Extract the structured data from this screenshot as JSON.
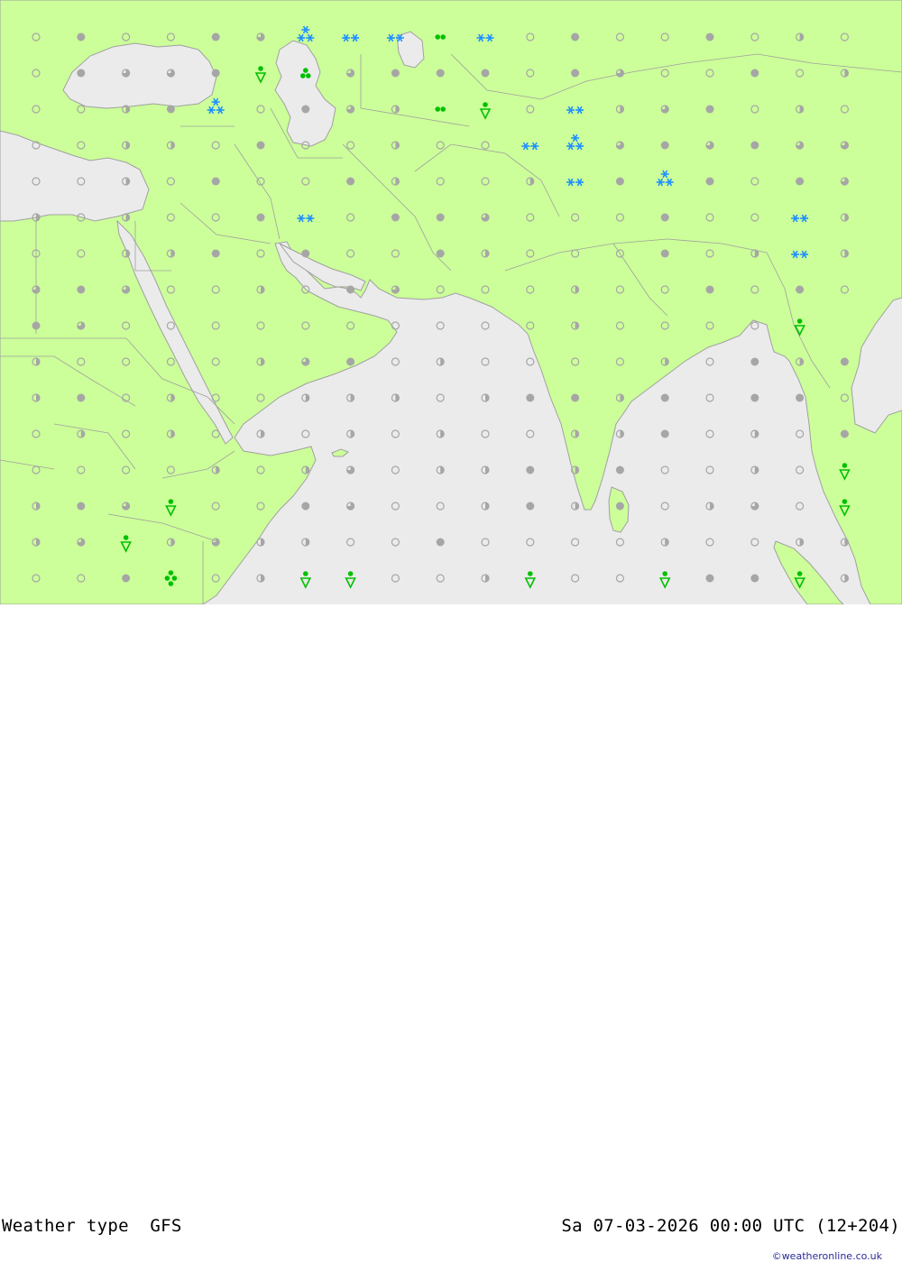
{
  "title": {
    "label": "Weather type",
    "model": "GFS",
    "datetime": "Sa 07-03-2026 00:00 UTC (12+204)"
  },
  "credit": "©weatheronline.co.uk",
  "colors": {
    "land": "#ccff99",
    "sea": "#ebebeb",
    "border": "#a0a0a0",
    "dot": "#a6a6a6",
    "snow": "#1e90ff",
    "rain": "#00c000"
  },
  "grid": {
    "cols": 19,
    "rows": 16,
    "symbols": [
      "ocoocfsssrsocoocoho",
      "ocffcdlfcccocfoocoh",
      "oohcsocfhrdoshfcoho",
      "oohhocoohoossfcfcff",
      "oohocoochoohscscocf",
      "hohoocsoccfooocoosh",
      "oohhcocoochooocohsh",
      "fcfoohocfooohoococo",
      "cfoooooooooohooood",
      "hoooohfcohoooohochc",
      "hcohoohhhohcchcocco",
      "ohohohohohoohhcohoc",
      "oooohohfohhchcoohod",
      "hcfdoocfoohchcohfod",
      "hfdhfhhoocoooohoohh",
      "oocaohddoohdoodccdh"
    ]
  }
}
